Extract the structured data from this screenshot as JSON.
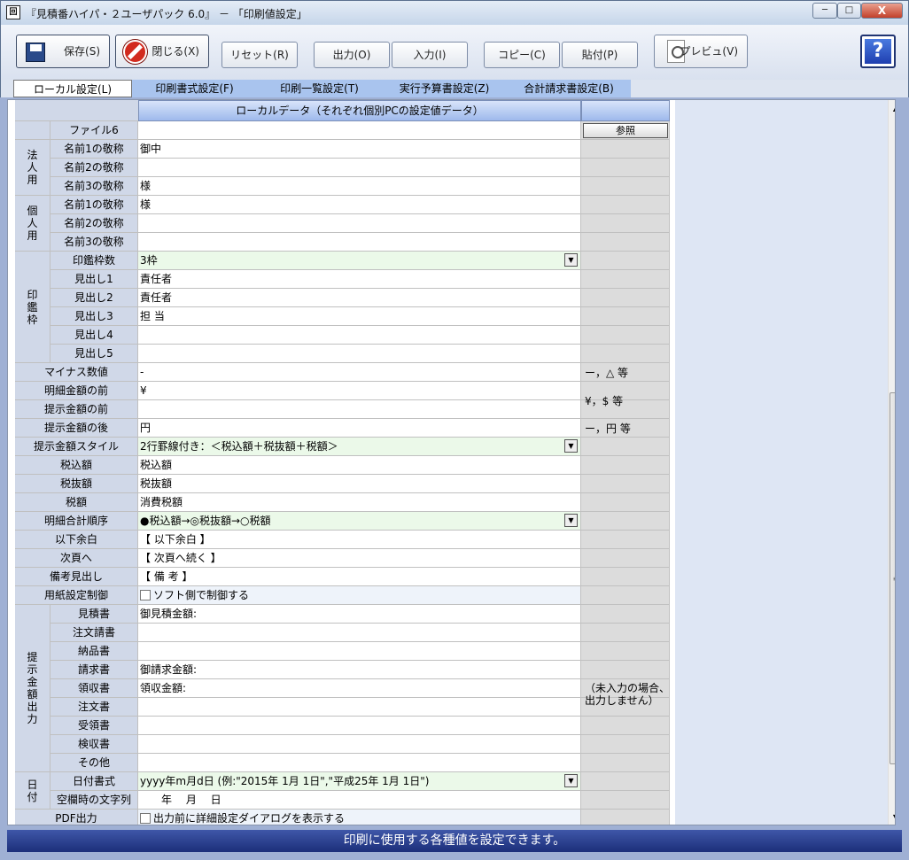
{
  "window": {
    "title": "『見積番ハイパ・２ユーザパック 6.0』 － 「印刷値設定」",
    "app_icon": "回",
    "min": "─",
    "max": "□",
    "close": "X"
  },
  "toolbar": {
    "save": "保存(S)",
    "close": "閉じる(X)",
    "reset": "リセット(R)",
    "output": "出力(O)",
    "input": "入力(I)",
    "copy": "コピー(C)",
    "paste": "貼付(P)",
    "preview": "プレビュ(V)",
    "help": "?"
  },
  "tabs": [
    {
      "label": "ローカル設定(L)",
      "active": true
    },
    {
      "label": "印刷書式設定(F)",
      "active": false
    },
    {
      "label": "印刷一覧設定(T)",
      "active": false
    },
    {
      "label": "実行予算書設定(Z)",
      "active": false
    },
    {
      "label": "合計請求書設定(B)",
      "active": false
    }
  ],
  "grid": {
    "header": "ローカルデータ（それぞれ個別PCの設定値データ）",
    "browse_button": "参照",
    "groups": {
      "corporate": "法人用",
      "personal": "個人用",
      "seal": "印鑑枠",
      "amount_output": "提示金額出力",
      "date": "日付"
    },
    "rows": {
      "file6": {
        "label": "ファイル6",
        "value": ""
      },
      "corp_name1": {
        "label": "名前1の敬称",
        "value": "御中"
      },
      "corp_name2": {
        "label": "名前2の敬称",
        "value": ""
      },
      "corp_name3": {
        "label": "名前3の敬称",
        "value": "様"
      },
      "pers_name1": {
        "label": "名前1の敬称",
        "value": "様"
      },
      "pers_name2": {
        "label": "名前2の敬称",
        "value": ""
      },
      "pers_name3": {
        "label": "名前3の敬称",
        "value": ""
      },
      "seal_count": {
        "label": "印鑑枠数",
        "value": "3枠"
      },
      "heading1": {
        "label": "見出し1",
        "value": "責任者"
      },
      "heading2": {
        "label": "見出し2",
        "value": "責任者"
      },
      "heading3": {
        "label": "見出し3",
        "value": "担 当"
      },
      "heading4": {
        "label": "見出し4",
        "value": ""
      },
      "heading5": {
        "label": "見出し5",
        "value": ""
      },
      "minus": {
        "label": "マイナス数値",
        "value": "-",
        "note": "ー，△ 等"
      },
      "detail_before": {
        "label": "明細金額の前",
        "value": "¥"
      },
      "amount_before": {
        "label": "提示金額の前",
        "value": "",
        "note": "¥，$ 等"
      },
      "amount_after": {
        "label": "提示金額の後",
        "value": "円",
        "note": "ー，円 等"
      },
      "amount_style": {
        "label": "提示金額スタイル",
        "value": "2行罫線付き：＜税込額＋税抜額＋税額＞"
      },
      "tax_incl": {
        "label": "税込額",
        "value": "税込額"
      },
      "tax_excl": {
        "label": "税抜額",
        "value": "税抜額"
      },
      "tax": {
        "label": "税額",
        "value": "消費税額"
      },
      "detail_order": {
        "label": "明細合計順序",
        "value": "●税込額→◎税抜額→○税額"
      },
      "blank_below": {
        "label": "以下余白",
        "value": "【 以下余白 】"
      },
      "next_page": {
        "label": "次頁へ",
        "value": "【 次頁へ続く 】"
      },
      "remarks": {
        "label": "備考見出し",
        "value": "【 備 考 】"
      },
      "paper_control": {
        "label": "用紙設定制御",
        "value": "ソフト側で制御する"
      },
      "estimate": {
        "label": "見積書",
        "value": "御見積金額:"
      },
      "order_form": {
        "label": "注文請書",
        "value": ""
      },
      "delivery": {
        "label": "納品書",
        "value": ""
      },
      "invoice": {
        "label": "請求書",
        "value": "御請求金額:"
      },
      "receipt": {
        "label": "領収書",
        "value": "領収金額:"
      },
      "purchase_order": {
        "label": "注文書",
        "value": ""
      },
      "acceptance": {
        "label": "受領書",
        "value": ""
      },
      "inspection": {
        "label": "検収書",
        "value": ""
      },
      "other": {
        "label": "その他",
        "value": ""
      },
      "date_format": {
        "label": "日付書式",
        "value": "yyyy年m月d日 (例:\"2015年 1月 1日\",\"平成25年 1月 1日\")"
      },
      "blank_date": {
        "label": "空欄時の文字列",
        "value": "　　年　 月　 日"
      },
      "pdf_output": {
        "label": "PDF出力",
        "value": "出力前に詳細設定ダイアログを表示する"
      }
    },
    "amount_note": "（未入力の場合、出力しません）"
  },
  "status": {
    "text": "印刷に使用する各種値を設定できます。"
  }
}
